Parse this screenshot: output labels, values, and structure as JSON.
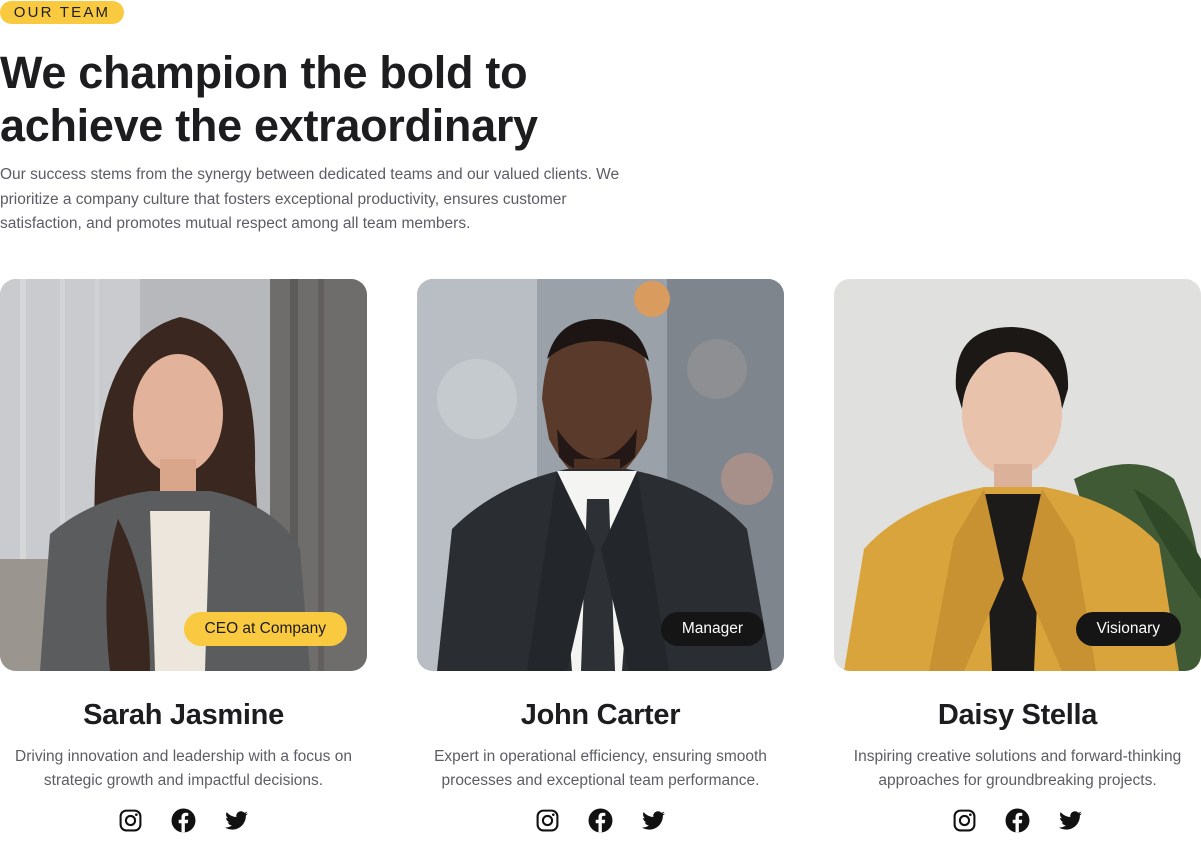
{
  "header": {
    "eyebrow": "OUR TEAM",
    "headline_line1": "We champion the bold to",
    "headline_line2": "achieve the extraordinary",
    "intro": "Our success stems from the synergy between dedicated teams and our valued clients. We prioritize a company culture that fosters exceptional productivity, ensures customer satisfaction, and promotes mutual respect among all team members."
  },
  "colors": {
    "accent": "#f9c940",
    "dark_badge": "#151516",
    "heading": "#1d1d1f",
    "body_text": "#5c5c66"
  },
  "team": [
    {
      "name": "Sarah Jasmine",
      "role": "CEO at Company",
      "bio": "Driving innovation and leadership with a focus on strategic growth and impactful decisions.",
      "socials": [
        "instagram-icon",
        "facebook-icon",
        "twitter-icon"
      ]
    },
    {
      "name": "John Carter",
      "role": "Manager",
      "bio": "Expert in operational efficiency, ensuring smooth processes and exceptional team performance.",
      "socials": [
        "instagram-icon",
        "facebook-icon",
        "twitter-icon"
      ]
    },
    {
      "name": "Daisy Stella",
      "role": "Visionary",
      "bio": "Inspiring creative solutions and forward-thinking approaches for groundbreaking projects.",
      "socials": [
        "instagram-icon",
        "facebook-icon",
        "twitter-icon"
      ]
    }
  ]
}
